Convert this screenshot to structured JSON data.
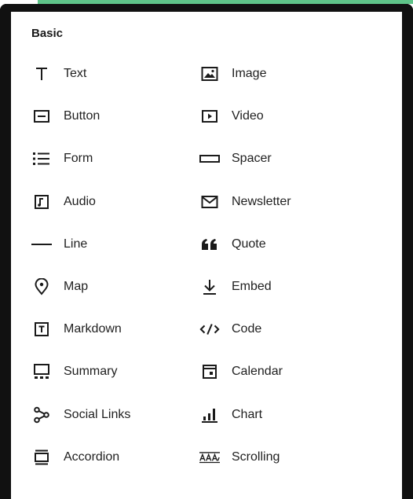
{
  "section": {
    "title": "Basic"
  },
  "blocks": [
    {
      "label": "Text",
      "icon": "text-icon"
    },
    {
      "label": "Image",
      "icon": "image-icon"
    },
    {
      "label": "Button",
      "icon": "button-icon"
    },
    {
      "label": "Video",
      "icon": "video-icon"
    },
    {
      "label": "Form",
      "icon": "form-icon"
    },
    {
      "label": "Spacer",
      "icon": "spacer-icon"
    },
    {
      "label": "Audio",
      "icon": "audio-icon"
    },
    {
      "label": "Newsletter",
      "icon": "newsletter-icon"
    },
    {
      "label": "Line",
      "icon": "line-icon"
    },
    {
      "label": "Quote",
      "icon": "quote-icon"
    },
    {
      "label": "Map",
      "icon": "map-pin-icon"
    },
    {
      "label": "Embed",
      "icon": "embed-icon"
    },
    {
      "label": "Markdown",
      "icon": "markdown-icon"
    },
    {
      "label": "Code",
      "icon": "code-icon"
    },
    {
      "label": "Summary",
      "icon": "summary-icon"
    },
    {
      "label": "Calendar",
      "icon": "calendar-icon"
    },
    {
      "label": "Social Links",
      "icon": "social-links-icon"
    },
    {
      "label": "Chart",
      "icon": "chart-icon"
    },
    {
      "label": "Accordion",
      "icon": "accordion-icon"
    },
    {
      "label": "Scrolling",
      "icon": "scrolling-icon"
    }
  ],
  "icon_glyphs": {
    "markdown": "T",
    "quote": "❝❝",
    "code": "</>",
    "scrolling": "AAA"
  },
  "colors": {
    "frame": "#111111",
    "accent_strip": "#5fc489",
    "text": "#1f1f1f"
  }
}
